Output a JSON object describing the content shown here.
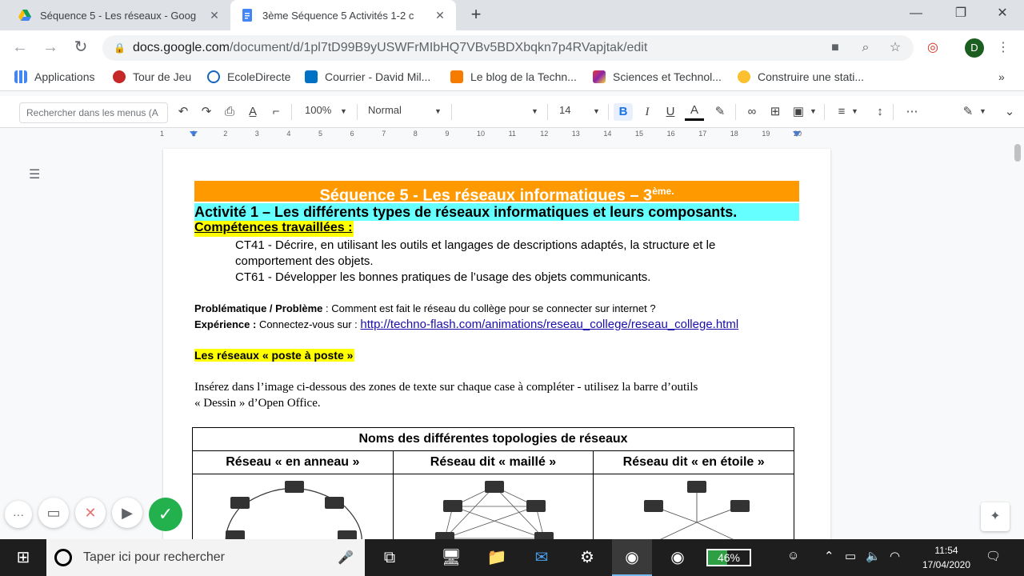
{
  "browser": {
    "tabs": [
      {
        "label": "Séquence 5 - Les réseaux - Goog"
      },
      {
        "label": "3ème Séquence 5 Activités 1-2 c"
      }
    ],
    "url_host": "docs.google.com",
    "url_path": "/document/d/1pl7tD99B9yUSWFrMIbHQ7VBv5BDXbqkn7p4RVapjtak/edit",
    "avatar_initial": "D",
    "bookmarks": [
      {
        "label": "Applications"
      },
      {
        "label": "Tour de Jeu"
      },
      {
        "label": "EcoleDirecte"
      },
      {
        "label": "Courrier - David Mil..."
      },
      {
        "label": "Le blog de la Techn..."
      },
      {
        "label": "Sciences et Technol..."
      },
      {
        "label": "Construire une stati..."
      }
    ],
    "bookmarks_more": "»"
  },
  "docs_toolbar": {
    "menu_search_placeholder": "Rechercher dans les menus (A",
    "zoom": "100%",
    "style": "Normal",
    "font_size": "14"
  },
  "ruler": {
    "ticks": [
      "1",
      "1",
      "2",
      "3",
      "4",
      "5",
      "6",
      "7",
      "8",
      "9",
      "10",
      "11",
      "12",
      "13",
      "14",
      "15",
      "16",
      "17",
      "18",
      "19",
      "20"
    ]
  },
  "document": {
    "title_main": "Séquence 5 - Les réseaux informatiques – 3",
    "title_sup": "ème.",
    "activity": "Activité 1 – Les différents types de réseaux informatiques et leurs composants.",
    "competences": "Compétences travaillées :",
    "ct41_line1": "CT41 - Décrire, en utilisant les outils et langages de descriptions adaptés, la structure et le",
    "ct41_line2": "comportement des objets.",
    "ct61": "CT61 - Développer les bonnes pratiques de l’usage des objets communicants.",
    "problematique_label": "Problématique / Problème",
    "problematique_text": " : Comment est fait le réseau du collège pour se connecter sur internet ?",
    "experience_label": "Expérience :",
    "experience_text": " Connectez-vous sur : ",
    "experience_link": "http://techno-flash.com/animations/reseau_college/reseau_college.html",
    "reseaux_heading": "Les réseaux « poste à poste »",
    "instruction_line1": "Insérez dans l’image ci-dessous des zones de texte sur chaque case à compléter - utilisez la barre d’outils",
    "instruction_line2": "« Dessin » d’Open Office.",
    "table": {
      "header": "Noms des différentes topologies de réseaux",
      "columns": [
        "Réseau « en anneau »",
        "Réseau dit « maillé »",
        "Réseau dit « en étoile »"
      ]
    }
  },
  "overlay_buttons": {
    "more": "···",
    "check": "✓"
  },
  "taskbar": {
    "search_placeholder": "Taper ici pour rechercher",
    "battery_percent": "46%",
    "battery_level": 0.46,
    "time": "11:54",
    "date": "17/04/2020"
  }
}
